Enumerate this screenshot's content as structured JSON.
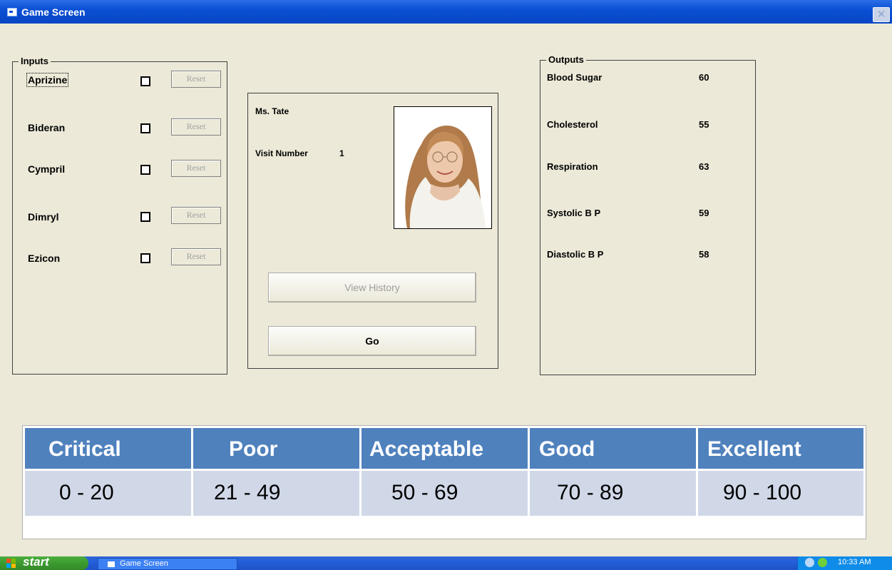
{
  "window": {
    "title": "Game Screen"
  },
  "inputs": {
    "group_label": "Inputs",
    "reset_label": "Reset",
    "drugs": [
      {
        "name": "Aprizine",
        "checked": false
      },
      {
        "name": "Bideran",
        "checked": false
      },
      {
        "name": "Cympril",
        "checked": false
      },
      {
        "name": "Dimryl",
        "checked": false
      },
      {
        "name": "Ezicon",
        "checked": false
      }
    ]
  },
  "patient": {
    "name": "Ms. Tate",
    "visit_label": "Visit Number",
    "visit_number": "1",
    "view_history_label": "View History",
    "go_label": "Go"
  },
  "outputs": {
    "group_label": "Outputs",
    "items": [
      {
        "label": "Blood Sugar",
        "value": "60"
      },
      {
        "label": "Cholesterol",
        "value": "55"
      },
      {
        "label": "Respiration",
        "value": "63"
      },
      {
        "label": "Systolic B P",
        "value": "59"
      },
      {
        "label": "Diastolic B P",
        "value": "58"
      }
    ]
  },
  "rating_table": {
    "headers": [
      "Critical",
      "Poor",
      "Acceptable",
      "Good",
      "Excellent"
    ],
    "ranges": [
      "0 - 20",
      "21 - 49",
      "50 - 69",
      "70 - 89",
      "90 - 100"
    ],
    "header_color": "#4f81bd",
    "cell_color": "#d0d8e8"
  },
  "taskbar": {
    "start_label": "start",
    "task_label": "Game Screen",
    "clock": "10:33 AM"
  }
}
